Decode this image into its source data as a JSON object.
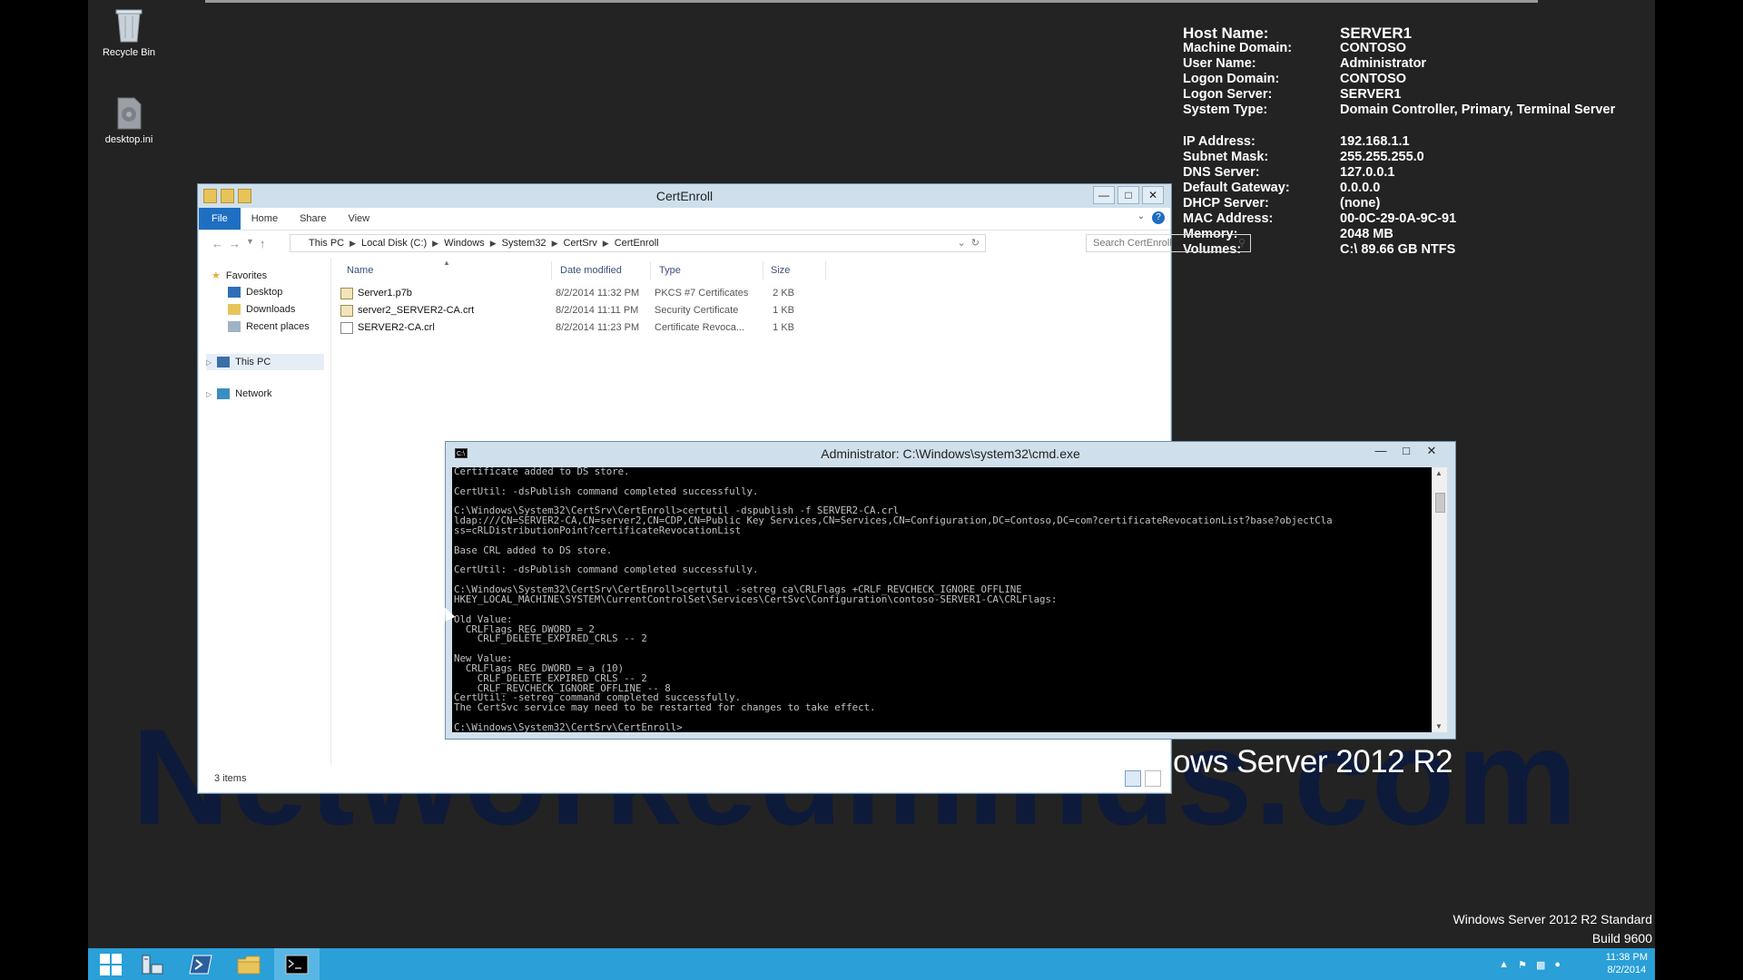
{
  "desktop": {
    "icons": [
      {
        "label": "Recycle Bin",
        "icon": "recycle-bin-icon"
      },
      {
        "label": "desktop.ini",
        "icon": "ini-file-icon"
      }
    ],
    "bginfo": [
      {
        "key": "Host Name:",
        "value": "SERVER1"
      },
      {
        "key": "Machine Domain:",
        "value": "CONTOSO"
      },
      {
        "key": "User Name:",
        "value": "Administrator"
      },
      {
        "key": "Logon Domain:",
        "value": "CONTOSO"
      },
      {
        "key": "Logon Server:",
        "value": "SERVER1"
      },
      {
        "key": "System Type:",
        "value": "Domain Controller, Primary, Terminal Server"
      },
      {
        "key": "IP Address:",
        "value": "192.168.1.1"
      },
      {
        "key": "Subnet Mask:",
        "value": "255.255.255.0"
      },
      {
        "key": "DNS Server:",
        "value": "127.0.0.1"
      },
      {
        "key": "Default Gateway:",
        "value": "0.0.0.0"
      },
      {
        "key": "DHCP Server:",
        "value": "(none)"
      },
      {
        "key": "MAC Address:",
        "value": "00-0C-29-0A-9C-91"
      },
      {
        "key": "Memory:",
        "value": "2048 MB"
      },
      {
        "key": "Volumes:",
        "value": "C:\\ 89.66 GB NTFS"
      }
    ],
    "watermark": "Networkedminds.com",
    "brand": "ows Server 2012 R2",
    "edition_line1": "Windows Server 2012 R2 Standard",
    "edition_line2": "Build 9600"
  },
  "explorer": {
    "title": "CertEnroll",
    "ribbon_tabs": [
      "File",
      "Home",
      "Share",
      "View"
    ],
    "breadcrumb": [
      "This PC",
      "Local Disk (C:)",
      "Windows",
      "System32",
      "CertSrv",
      "CertEnroll"
    ],
    "search_placeholder": "Search CertEnroll",
    "nav": {
      "favorites": "Favorites",
      "favorites_items": [
        "Desktop",
        "Downloads",
        "Recent places"
      ],
      "this_pc": "This PC",
      "network": "Network"
    },
    "columns": [
      "Name",
      "Date modified",
      "Type",
      "Size"
    ],
    "files": [
      {
        "name": "Server1.p7b",
        "date": "8/2/2014 11:32 PM",
        "type": "PKCS #7 Certificates",
        "size": "2 KB"
      },
      {
        "name": "server2_SERVER2-CA.crt",
        "date": "8/2/2014 11:11 PM",
        "type": "Security Certificate",
        "size": "1 KB"
      },
      {
        "name": "SERVER2-CA.crl",
        "date": "8/2/2014 11:23 PM",
        "type": "Certificate Revoca...",
        "size": "1 KB"
      }
    ],
    "status_count": "3 items"
  },
  "cmd": {
    "title": "Administrator: C:\\Windows\\system32\\cmd.exe",
    "icon_label": "C:\\",
    "output": "Certificate added to DS store.\n\nCertUtil: -dsPublish command completed successfully.\n\nC:\\Windows\\System32\\CertSrv\\CertEnroll>certutil -dspublish -f SERVER2-CA.crl\nldap:///CN=SERVER2-CA,CN=server2,CN=CDP,CN=Public Key Services,CN=Services,CN=Configuration,DC=Contoso,DC=com?certificateRevocationList?base?objectCla\nss=cRLDistributionPoint?certificateRevocationList\n\nBase CRL added to DS store.\n\nCertUtil: -dsPublish command completed successfully.\n\nC:\\Windows\\System32\\CertSrv\\CertEnroll>certutil -setreg ca\\CRLFlags +CRLF_REVCHECK_IGNORE_OFFLINE\nHKEY_LOCAL_MACHINE\\SYSTEM\\CurrentControlSet\\Services\\CertSvc\\Configuration\\contoso-SERVER1-CA\\CRLFlags:\n\nOld Value:\n  CRLFlags REG_DWORD = 2\n    CRLF_DELETE_EXPIRED_CRLS -- 2\n\nNew Value:\n  CRLFlags REG_DWORD = a (10)\n    CRLF_DELETE_EXPIRED_CRLS -- 2\n    CRLF_REVCHECK_IGNORE_OFFLINE -- 8\nCertUtil: -setreg command completed successfully.\nThe CertSvc service may need to be restarted for changes to take effect.\n\nC:\\Windows\\System32\\CertSrv\\CertEnroll>"
  },
  "taskbar": {
    "buttons": [
      "start-button",
      "server-manager-button",
      "powershell-button",
      "file-explorer-button",
      "cmd-button"
    ],
    "time": "11:38 PM",
    "date": "8/2/2014"
  },
  "colors": {
    "desktop_bg": "#232323",
    "taskbar": "#2a9fd8",
    "window_frame": "#cfe0ec",
    "ribbon_file": "#1e6fc1"
  }
}
